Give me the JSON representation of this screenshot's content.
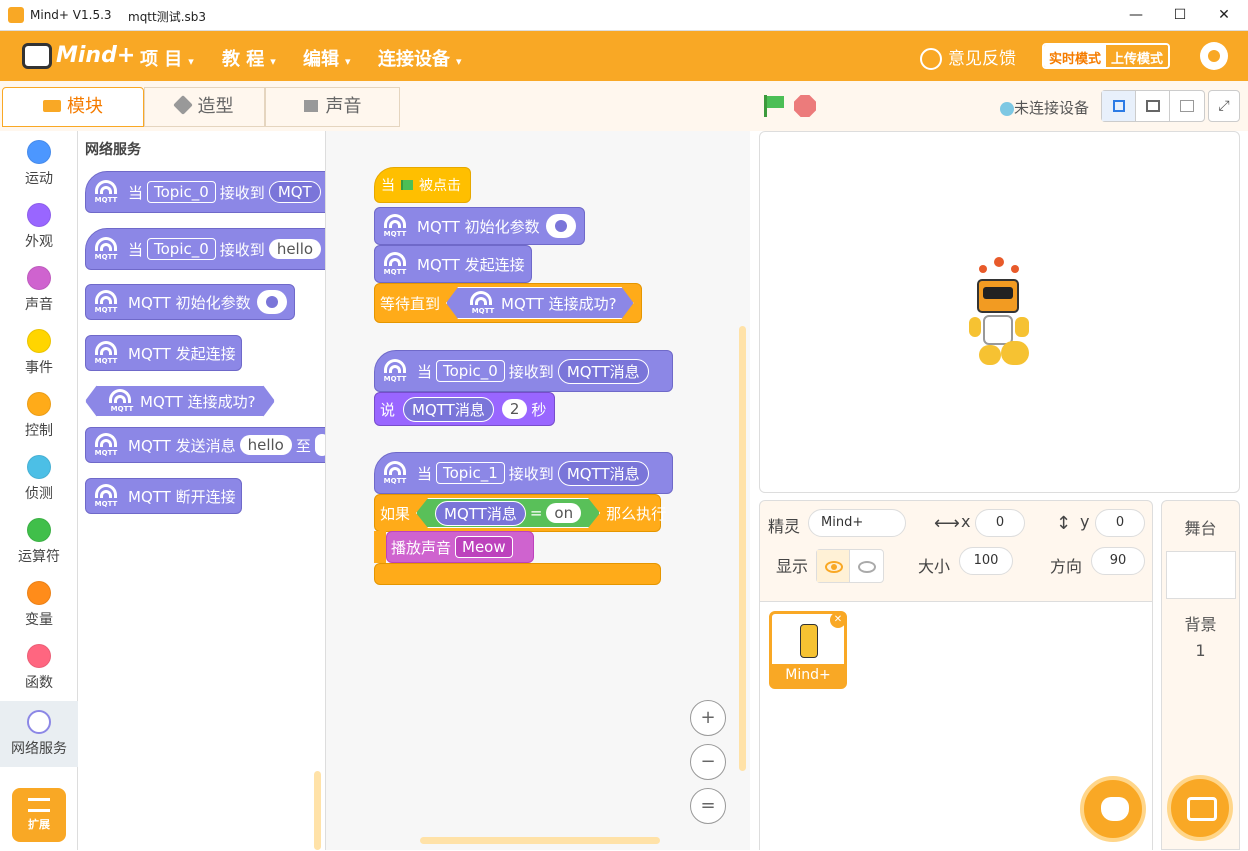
{
  "titlebar": {
    "app": "Mind+ V1.5.3",
    "file": "mqtt测试.sb3",
    "min": "—",
    "max": "☐",
    "close": "✕"
  },
  "menubar": {
    "logo": "Mind+",
    "items": [
      {
        "label": "项 目",
        "caret": "▾"
      },
      {
        "label": "教 程",
        "caret": "▾"
      },
      {
        "label": "编辑",
        "caret": "▾"
      },
      {
        "label": "连接设备",
        "caret": "▾"
      }
    ],
    "feedback": "意见反馈",
    "mode_live": "实时模式",
    "mode_upload": "上传模式",
    "colors": {
      "accent": "#f9a825"
    }
  },
  "tabs": [
    {
      "label": "模块"
    },
    {
      "label": "造型"
    },
    {
      "label": "声音"
    }
  ],
  "categories": [
    {
      "label": "运动",
      "color": "#4c97ff"
    },
    {
      "label": "外观",
      "color": "#9966ff"
    },
    {
      "label": "声音",
      "color": "#cf63cf"
    },
    {
      "label": "事件",
      "color": "#ffd500"
    },
    {
      "label": "控制",
      "color": "#ffab19"
    },
    {
      "label": "侦测",
      "color": "#4cbfe6"
    },
    {
      "label": "运算符",
      "color": "#40bf4a"
    },
    {
      "label": "变量",
      "color": "#ff8c1a"
    },
    {
      "label": "函数",
      "color": "#ff6680"
    },
    {
      "label": "网络服务",
      "color": "#8c87e6"
    }
  ],
  "extension_label": "扩展",
  "palette": {
    "title": "网络服务",
    "mqtt_icon": "MQTT",
    "b1": {
      "when": "当",
      "topic": "Topic_0",
      "recv": "接收到",
      "msg": "MQT"
    },
    "b2": {
      "when": "当",
      "topic": "Topic_0",
      "recv": "接收到",
      "msg": "hello"
    },
    "b3": "MQTT 初始化参数",
    "b4": "MQTT 发起连接",
    "b5": "MQTT 连接成功?",
    "b6": {
      "text": "MQTT 发送消息",
      "msg": "hello",
      "to": "至"
    },
    "b7": "MQTT 断开连接"
  },
  "script1": {
    "when": "当",
    "flag_clicked": "被点击",
    "init": "MQTT 初始化参数",
    "connect": "MQTT 发起连接",
    "wait": "等待直到",
    "connected": "MQTT 连接成功?"
  },
  "script2": {
    "when": "当",
    "topic": "Topic_0",
    "recv": "接收到",
    "msg": "MQTT消息",
    "say": "说",
    "say_msg": "MQTT消息",
    "secs": "2",
    "sec_unit": "秒"
  },
  "script3": {
    "when": "当",
    "topic": "Topic_1",
    "recv": "接收到",
    "msg": "MQTT消息",
    "if": "如果",
    "cmp_left": "MQTT消息",
    "eq": "=",
    "cmp_right": "on",
    "then": "那么执行",
    "play": "播放声音",
    "sound": "Meow"
  },
  "zoom": {
    "in": "+",
    "out": "−",
    "reset": "="
  },
  "stage_header": {
    "device_status": "未连接设备"
  },
  "sprite": {
    "label_sprite": "精灵",
    "name": "Mind+",
    "x_label": "x",
    "x": "0",
    "y_label": "y",
    "y": "0",
    "show_label": "显示",
    "size_label": "大小",
    "size": "100",
    "dir_label": "方向",
    "dir": "90",
    "thumb_name": "Mind+"
  },
  "stage_panel": {
    "title": "舞台",
    "backdrop_label": "背景",
    "backdrop_count": "1"
  }
}
